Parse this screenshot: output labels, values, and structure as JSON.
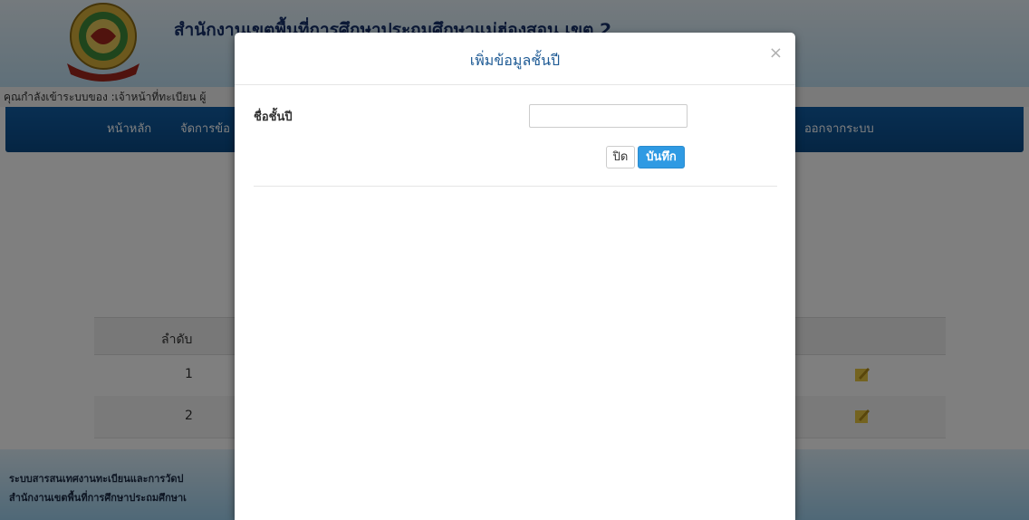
{
  "header": {
    "site_title": "สำนักงานเขตพื้นที่การศึกษาประถมศึกษาแม่ฮ่องสอน เขต 2"
  },
  "userbar": {
    "text": "คุณกำลังเข้าระบบของ :เจ้าหน้าที่ทะเบียน ผู้"
  },
  "nav": {
    "home": "หน้าหลัก",
    "manage": "จัดการข้อ",
    "logout": "ออกจากระบบ"
  },
  "table": {
    "col_order": "ลำดับ",
    "rows": [
      "1",
      "2"
    ],
    "edit_icon": "edit-icon"
  },
  "footer": {
    "line1": "ระบบสารสนเทศงานทะเบียนและการวัดป",
    "line2": "สำนักงานเขตพื้นที่การศึกษาประถมศึกษาเ"
  },
  "modal": {
    "title": "เพิ่มข้อมูลชั้นปี",
    "close_symbol": "×",
    "field_label": "ชื่อชั้นปี",
    "field_value": "",
    "btn_close": "ปิด",
    "btn_save": "บันทึก"
  },
  "colors": {
    "navbar": "#0a4a86",
    "save_button": "#2f9ae3",
    "modal_title": "#1f5b95"
  }
}
